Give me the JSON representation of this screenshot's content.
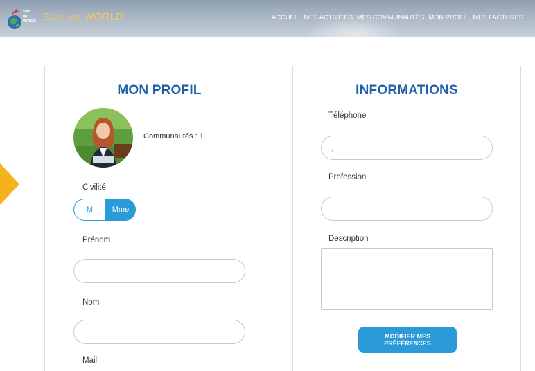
{
  "header": {
    "brand": "Start-up WORLD",
    "logo_lines": [
      "Start",
      "up",
      "WORLD"
    ],
    "nav": [
      "ACCUEIL",
      "MES ACTIVITÉS",
      "MES COMMUNAUTÉS",
      "MON PROFIL",
      "MES FACTURES"
    ]
  },
  "profile": {
    "title": "MON PROFIL",
    "communities_label": "Communautés : 1",
    "civilite_label": "Civilité",
    "civilite_options": [
      "M",
      "Mme"
    ],
    "civilite_selected": "Mme",
    "prenom_label": "Prénom",
    "prenom_value": "",
    "nom_label": "Nom",
    "nom_value": "",
    "mail_label": "Mail"
  },
  "informations": {
    "title": "INFORMATIONS",
    "telephone_label": "Téléphone",
    "telephone_value": ",",
    "profession_label": "Profession",
    "profession_value": "",
    "description_label": "Description",
    "description_value": "",
    "submit_label": "MODIFIER MES PRÉFÉRENCES"
  },
  "colors": {
    "accent": "#2a9ad8",
    "title": "#1f5fa8",
    "brand": "#f2c46a",
    "arrow": "#f6b21a"
  }
}
